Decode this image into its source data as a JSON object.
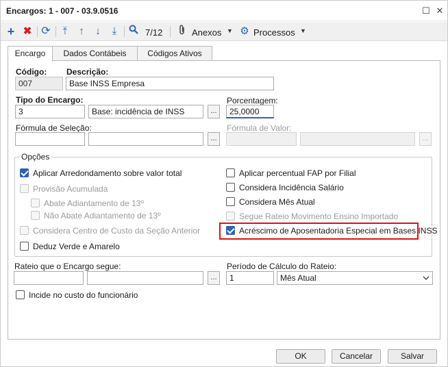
{
  "window": {
    "title": "Encargos: 1 - 007 - 03.9.0516",
    "maximize_glyph": "☐",
    "close_glyph": "✕"
  },
  "toolbar": {
    "record_position": "7/12",
    "anexos_label": "Anexos",
    "processos_label": "Processos",
    "icons": [
      "add-icon",
      "delete-icon",
      "refresh-icon",
      "first-record-icon",
      "previous-record-icon",
      "next-record-icon",
      "last-record-icon",
      "search-icon",
      "paperclip-icon",
      "gear-icon"
    ]
  },
  "tabs": [
    {
      "label": "Encargo",
      "active": true
    },
    {
      "label": "Dados Contábeis",
      "active": false
    },
    {
      "label": "Códigos Ativos",
      "active": false
    }
  ],
  "form": {
    "codigo_label": "Código:",
    "codigo_value": "007",
    "descricao_label": "Descrição:",
    "descricao_value": "Base INSS Empresa",
    "tipo_label": "Tipo do Encargo:",
    "tipo_code": "3",
    "tipo_desc": "Base: incidência de INSS",
    "porcentagem_label": "Porcentagem:",
    "porcentagem_value": "25,0000",
    "formula_selecao_label": "Fórmula de Seleção:",
    "formula_valor_label": "Fórmula de Valor:",
    "ellipsis": "..."
  },
  "opcoes": {
    "title": "Opções",
    "left": [
      {
        "label": "Aplicar Arredondamento sobre valor total",
        "checked": true,
        "disabled": false
      },
      {
        "label": "Provisão Acumulada",
        "checked": false,
        "disabled": true
      },
      {
        "label": "Abate Adiantamento de 13º",
        "checked": false,
        "disabled": true
      },
      {
        "label": "Não Abate Adiantamento de 13º",
        "checked": false,
        "disabled": true
      },
      {
        "label": "Considera Centro de Custo da Seção Anterior",
        "checked": false,
        "disabled": true
      },
      {
        "label": "Deduz Verde e Amarelo",
        "checked": false,
        "disabled": false
      }
    ],
    "right": [
      {
        "label": "Aplicar percentual FAP por Filial",
        "checked": false,
        "disabled": false
      },
      {
        "label": "Considera Incidência Salário",
        "checked": false,
        "disabled": false
      },
      {
        "label": "Considera Mês Atual",
        "checked": false,
        "disabled": false
      },
      {
        "label": "Segue Rateio Movimento Ensino Importado",
        "checked": false,
        "disabled": true
      },
      {
        "label": "Acréscimo de Aposentadoria Especial em Bases INSS",
        "checked": true,
        "disabled": false
      }
    ]
  },
  "rateio": {
    "segue_label": "Rateio que o Encargo segue:",
    "periodo_label": "Período de Cálculo do Rateio:",
    "periodo_value": "1",
    "periodo_option": "Mês Atual",
    "incide_label": "Incide no custo do funcionário"
  },
  "buttons": {
    "ok": "OK",
    "cancel": "Cancelar",
    "save": "Salvar"
  },
  "colors": {
    "accent": "#2b62b8",
    "delete": "#d42020",
    "highlight": "#e01010"
  }
}
